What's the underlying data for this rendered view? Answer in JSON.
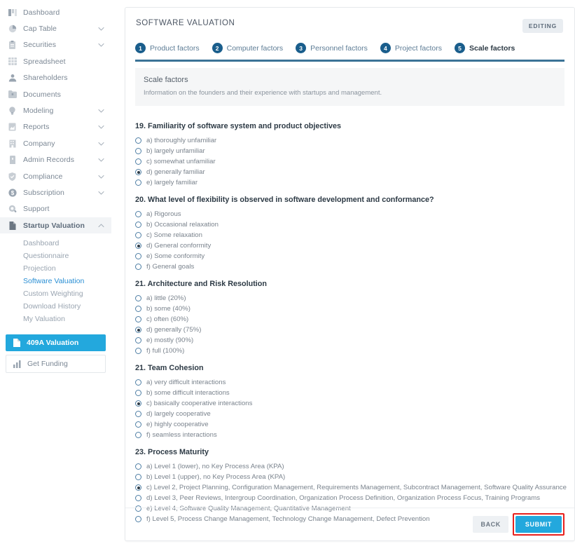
{
  "sidebar": {
    "items": [
      {
        "label": "Dashboard",
        "icon": "dashboard-icon",
        "chevron": ""
      },
      {
        "label": "Cap Table",
        "icon": "pie-chart-icon",
        "chevron": "down"
      },
      {
        "label": "Securities",
        "icon": "clipboard-icon",
        "chevron": "down"
      },
      {
        "label": "Spreadsheet",
        "icon": "grid-icon",
        "chevron": ""
      },
      {
        "label": "Shareholders",
        "icon": "person-icon",
        "chevron": ""
      },
      {
        "label": "Documents",
        "icon": "folder-icon",
        "chevron": ""
      },
      {
        "label": "Modeling",
        "icon": "lightbulb-icon",
        "chevron": "down"
      },
      {
        "label": "Reports",
        "icon": "report-icon",
        "chevron": "down"
      },
      {
        "label": "Company",
        "icon": "building-icon",
        "chevron": "down"
      },
      {
        "label": "Admin Records",
        "icon": "archive-icon",
        "chevron": "down"
      },
      {
        "label": "Compliance",
        "icon": "shield-check-icon",
        "chevron": "down"
      },
      {
        "label": "Subscription",
        "icon": "dollar-circle-icon",
        "chevron": "down"
      },
      {
        "label": "Support",
        "icon": "support-icon",
        "chevron": ""
      }
    ],
    "group": {
      "label": "Startup Valuation",
      "icon": "document-icon",
      "chevron": "up",
      "sub_items": [
        {
          "label": "Dashboard",
          "active": false
        },
        {
          "label": "Questionnaire",
          "active": false
        },
        {
          "label": "Projection",
          "active": false
        },
        {
          "label": "Software Valuation",
          "active": true
        },
        {
          "label": "Custom Weighting",
          "active": false
        },
        {
          "label": "Download History",
          "active": false
        },
        {
          "label": "My Valuation",
          "active": false
        }
      ]
    },
    "valuation_409a": {
      "label": "409A Valuation",
      "icon": "document-icon"
    },
    "get_funding": {
      "label": "Get Funding",
      "icon": "bar-chart-icon"
    }
  },
  "card": {
    "title": "SOFTWARE VALUATION",
    "editing_badge": "EDITING",
    "steps": [
      {
        "num": "1",
        "label": "Product factors",
        "active": false
      },
      {
        "num": "2",
        "label": "Computer factors",
        "active": false
      },
      {
        "num": "3",
        "label": "Personnel factors",
        "active": false
      },
      {
        "num": "4",
        "label": "Project factors",
        "active": false
      },
      {
        "num": "5",
        "label": "Scale factors",
        "active": true
      }
    ],
    "info": {
      "title": "Scale factors",
      "subtitle": "Information on the founders and their experience with startups and management."
    },
    "questions": [
      {
        "title": "19. Familiarity of software system and product objectives",
        "options": [
          {
            "label": "a) thoroughly unfamiliar",
            "selected": false
          },
          {
            "label": "b) largely unfamiliar",
            "selected": false
          },
          {
            "label": "c) somewhat unfamiliar",
            "selected": false
          },
          {
            "label": "d) generally familiar",
            "selected": true
          },
          {
            "label": "e) largely familiar",
            "selected": false
          }
        ]
      },
      {
        "title": "20. What level of flexibility is observed in software development and conformance?",
        "options": [
          {
            "label": "a) Rigorous",
            "selected": false
          },
          {
            "label": "b) Occasional relaxation",
            "selected": false
          },
          {
            "label": "c) Some relaxation",
            "selected": false
          },
          {
            "label": "d) General conformity",
            "selected": true
          },
          {
            "label": "e) Some conformity",
            "selected": false
          },
          {
            "label": "f) General goals",
            "selected": false
          }
        ]
      },
      {
        "title": "21. Architecture and Risk Resolution",
        "options": [
          {
            "label": "a) little (20%)",
            "selected": false
          },
          {
            "label": "b) some (40%)",
            "selected": false
          },
          {
            "label": "c) often (60%)",
            "selected": false
          },
          {
            "label": "d) generally (75%)",
            "selected": true
          },
          {
            "label": "e) mostly (90%)",
            "selected": false
          },
          {
            "label": "f) full (100%)",
            "selected": false
          }
        ]
      },
      {
        "title": "21. Team Cohesion",
        "options": [
          {
            "label": "a) very difficult interactions",
            "selected": false
          },
          {
            "label": "b) some difficult interactions",
            "selected": false
          },
          {
            "label": "c) basically cooperative interactions",
            "selected": true
          },
          {
            "label": "d) largely cooperative",
            "selected": false
          },
          {
            "label": "e) highly cooperative",
            "selected": false
          },
          {
            "label": "f) seamless interactions",
            "selected": false
          }
        ]
      },
      {
        "title": "23. Process Maturity",
        "options": [
          {
            "label": "a) Level 1 (lower), no Key Process Area (KPA)",
            "selected": false
          },
          {
            "label": "b) Level 1 (upper), no Key Process Area (KPA)",
            "selected": false
          },
          {
            "label": "c) Level 2, Project Planning, Configuration Management, Requirements Management, Subcontract Management, Software Quality Assurance",
            "selected": true
          },
          {
            "label": "d) Level 3, Peer Reviews, Intergroup Coordination, Organization Process Definition, Organization Process Focus, Training Programs",
            "selected": false
          },
          {
            "label": "e) Level 4, Software Quality Management, Quantitative Management",
            "selected": false
          },
          {
            "label": "f) Level 5, Process Change Management, Technology Change Management, Defect Prevention",
            "selected": false
          }
        ]
      }
    ],
    "footer": {
      "back_label": "BACK",
      "submit_label": "SUBMIT"
    }
  },
  "colors": {
    "accent_cyan": "#23a8dd",
    "step_blue": "#1a5e8c",
    "bar_blue": "#3b7396",
    "highlight_red": "#e8201c",
    "muted_text": "#7b8794"
  }
}
